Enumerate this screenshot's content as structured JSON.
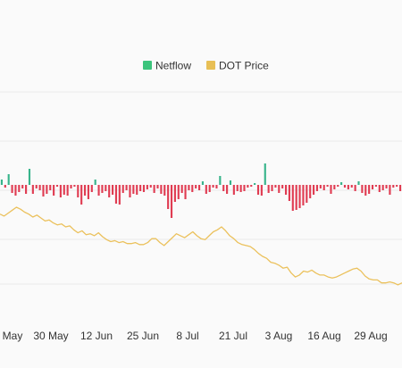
{
  "colors": {
    "background": "#fafafa",
    "grid": "#ebebeb",
    "netflow_positive": "#38b48b",
    "netflow_negative": "#e03c52",
    "price_line": "#ebc15c",
    "text": "#333333"
  },
  "legend": {
    "items": [
      {
        "label": "Netflow",
        "color": "#3cc47c"
      },
      {
        "label": "DOT Price",
        "color": "#e8bf55"
      }
    ]
  },
  "chart_data": {
    "type": "bar",
    "legend_position": "top-center",
    "grid": true,
    "x_tick_labels": [
      "May",
      "30 May",
      "12 Jun",
      "25 Jun",
      "8 Jul",
      "21 Jul",
      "3 Aug",
      "16 Aug",
      "29 Aug"
    ],
    "series": [
      {
        "name": "Netflow",
        "type": "bar",
        "values": [
          6,
          -3,
          12,
          -9,
          -12,
          -8,
          -4,
          -10,
          18,
          -10,
          -4,
          -6,
          -13,
          -10,
          -6,
          -12,
          -2,
          -14,
          -11,
          -12,
          -4,
          -2,
          -14,
          -22,
          -12,
          -16,
          -8,
          6,
          -12,
          -9,
          -7,
          -14,
          -11,
          -21,
          -22,
          -9,
          -6,
          -14,
          -10,
          -11,
          -7,
          -8,
          -5,
          -3,
          -9,
          -4,
          -10,
          -12,
          -27,
          -37,
          -19,
          -16,
          -9,
          -16,
          -6,
          -8,
          -4,
          -6,
          4,
          -10,
          -8,
          -3,
          -4,
          10,
          -7,
          -10,
          5,
          -11,
          -7,
          -8,
          -7,
          -3,
          -2,
          2,
          -11,
          -12,
          24,
          -9,
          -7,
          -3,
          -9,
          -4,
          -11,
          -18,
          -29,
          -28,
          -26,
          -23,
          -20,
          -15,
          -11,
          -7,
          -4,
          -6,
          -2,
          -10,
          -5,
          -2,
          3,
          -3,
          -5,
          -3,
          -7,
          4,
          -9,
          -12,
          -10,
          -5,
          -2,
          -8,
          -6,
          -4,
          -11,
          -3,
          -2,
          -7
        ]
      },
      {
        "name": "DOT Price",
        "type": "line",
        "values": [
          8.5,
          8.3,
          8.6,
          8.9,
          9.2,
          9.0,
          8.7,
          8.5,
          8.2,
          8.4,
          8.1,
          7.8,
          7.9,
          7.6,
          7.4,
          7.5,
          7.2,
          7.3,
          6.9,
          6.6,
          6.8,
          6.4,
          6.5,
          6.3,
          6.6,
          6.2,
          5.9,
          5.7,
          5.8,
          5.6,
          5.7,
          5.5,
          5.5,
          5.6,
          5.4,
          5.4,
          5.6,
          6.0,
          6.0,
          5.6,
          5.3,
          5.7,
          6.1,
          6.5,
          6.3,
          6.1,
          6.4,
          6.7,
          6.3,
          6.0,
          5.9,
          6.3,
          6.7,
          6.9,
          7.2,
          6.8,
          6.3,
          6.0,
          5.6,
          5.4,
          5.3,
          5.2,
          4.9,
          4.5,
          4.2,
          4.0,
          3.6,
          3.5,
          3.3,
          3.0,
          3.1,
          2.5,
          2.1,
          2.3,
          2.7,
          2.6,
          2.8,
          2.5,
          2.3,
          2.3,
          2.1,
          2.0,
          2.1,
          2.3,
          2.5,
          2.7,
          2.9,
          3.0,
          2.7,
          2.2,
          1.9,
          1.8,
          1.8,
          1.5,
          1.5,
          1.6,
          1.5,
          1.3,
          1.5
        ]
      }
    ]
  }
}
